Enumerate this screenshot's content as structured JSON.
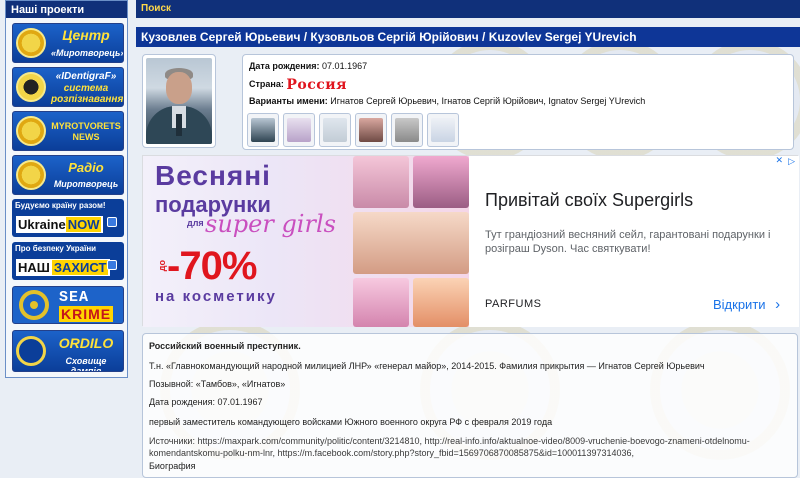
{
  "sidebar": {
    "header": "Наші проекти",
    "promos": [
      {
        "title": "Центр",
        "subtitle": "«Миротворець»"
      },
      {
        "title": "«IDentigraF»",
        "subtitle": "система розпізнавання"
      },
      {
        "title": "MYROTVORETS",
        "subtitle": "NEWS"
      },
      {
        "title": "Радіо",
        "subtitle": "Миротворець"
      }
    ],
    "banners": [
      {
        "top": "Будуємо країну разом!",
        "label": "Ukraine",
        "highlight": "NOW"
      },
      {
        "top": "Про безпеку України",
        "label": "НАШ",
        "highlight": "ЗАХИСТ"
      }
    ],
    "sea": {
      "line1": "SEA",
      "line2": "KRIME"
    },
    "ordilo": {
      "title": "ORDILO",
      "subtitle": "Сховище дампів"
    }
  },
  "main": {
    "search_tab": "Поиск",
    "title": "Кузовлев Сергей Юрьевич / Кузовльов Сергій Юрійович / Kuzovlev Sergej YUrevich",
    "info": {
      "birth_label": "Дата рождения:",
      "birth_value": "07.01.1967",
      "country_label": "Страна:",
      "country_value": "Россия",
      "variants_label": "Варианты имени:",
      "variants_value": "Игнатов Сергей Юрьевич, Ігнатов Сергій Юрійович, Ignatov Sergej YUrevich"
    }
  },
  "ad": {
    "left_line1": "Весняні",
    "left_line2": "подарунки",
    "left_line3": "для",
    "left_line4": "super girls",
    "left_do": "до",
    "left_discount": "-70%",
    "left_cosm": "на косметику",
    "headline": "Привітай своїх Supergirls",
    "description": "Тут грандіозний весняний сейл, гарантовані подарунки і розіграш Dyson. Час святкувати!",
    "brand": "PARFUMS",
    "cta": "Відкрити",
    "cta_arrow": "›"
  },
  "bio": {
    "heading": "Российский военный преступник.",
    "line1": "Т.н. «Главнокомандующий народной милицией ЛНР» «генерал майор», 2014-2015. Фамилия прикрытия — Игнатов Сергей Юрьевич",
    "line2": "Позывной:  «Тамбов», «Игнатов»",
    "line3": "Дата рождения: 07.01.1967",
    "line4": "первый заместитель командующего войсками Южного военного округа РФ с февраля 2019 года",
    "sources": "Источники: https://maxpark.com/community/politic/content/3214810, http://real-info.info/aktualnoe-video/8009-vruchenie-boevogo-znameni-otdelnomu-komendantskomu-polku-nm-lnr, https://m.facebook.com/story.php?story_fbid=1569706870085875&id=100011397314036,",
    "line6": "Биография"
  },
  "colors": {
    "nav_dark": "#10307a",
    "title_blue": "#0e3697",
    "country_red": "#e0151e",
    "ad_purple": "#5a3ba0",
    "ad_cta": "#1a73e8"
  }
}
